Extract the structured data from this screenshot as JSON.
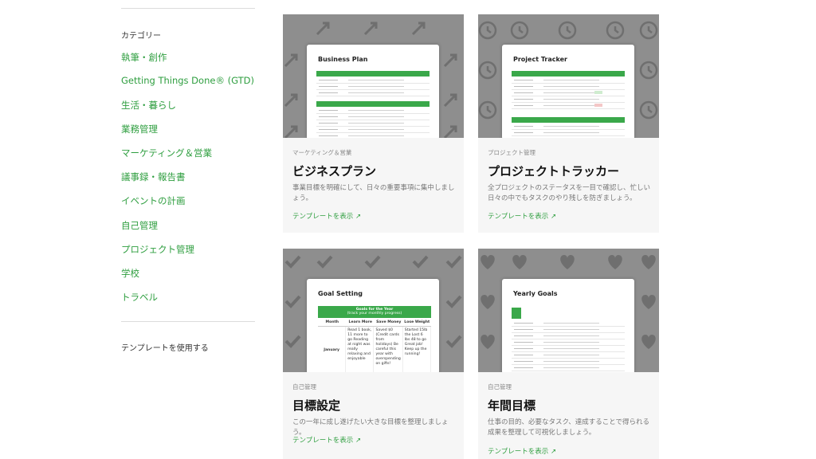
{
  "sidebar": {
    "heading": "カテゴリー",
    "items": [
      {
        "label": "執筆・創作"
      },
      {
        "label": "Getting Things Done® (GTD)"
      },
      {
        "label": "生活・暮らし"
      },
      {
        "label": "業務管理"
      },
      {
        "label": "マーケティング＆営業"
      },
      {
        "label": "議事録・報告書"
      },
      {
        "label": "イベントの計画"
      },
      {
        "label": "自己管理"
      },
      {
        "label": "プロジェクト管理"
      },
      {
        "label": "学校"
      },
      {
        "label": "トラベル"
      }
    ],
    "footer": "テンプレートを使用する"
  },
  "cards": [
    {
      "preview_title": "Business Plan",
      "preview_sections": [
        "Overview",
        "Market Analysis"
      ],
      "category": "マーケティング＆営業",
      "title": "ビジネスプラン",
      "description": "事業目標を明確にして、日々の重要事項に集中しましょう。",
      "link": "テンプレートを表示 ↗"
    },
    {
      "preview_title": "Project Tracker",
      "preview_sections": [
        "Project tasks"
      ],
      "category": "プロジェクト管理",
      "title": "プロジェクトトラッカー",
      "description": "全プロジェクトのステータスを一目で確認し、忙しい日々の中でもタスクのやり残しを防ぎましょう。",
      "link": "テンプレートを表示 ↗"
    },
    {
      "preview_title": "Goal Setting",
      "preview_table": {
        "header": "Goals for the Year",
        "subheader": "(track your monthly progress)",
        "columns": [
          "Month",
          "Learn More",
          "Save Money",
          "Lose Weight"
        ],
        "row_label": "January",
        "cells": [
          "Read 1 book, 11 more to go Reading at night was really relaxing and enjoyable",
          "Saved $0 (Credit cards from holidays) Be careful this year with overspending on gifts!",
          "Started 15lb the Lost 6 lbs 48 to go Great job! Keep up the running!"
        ]
      },
      "category": "自己管理",
      "title": "目標設定",
      "description": "この一年に成し遂げたい大きな目標を整理しましょう。",
      "link": "テンプレートを表示 ↗"
    },
    {
      "preview_title": "Yearly Goals",
      "category": "自己管理",
      "title": "年間目標",
      "description": "仕事の目的、必要なタスク、達成することで得られる成果を整理して可視化しましょう。",
      "link": "テンプレートを表示 ↗"
    }
  ],
  "colors": {
    "accent": "#2e9e3f",
    "preview_bg": "#8e8e8e",
    "table_green": "#3aa84a"
  },
  "icons": [
    "arrow-icon",
    "clock-icon",
    "check-icon",
    "heart-icon"
  ]
}
